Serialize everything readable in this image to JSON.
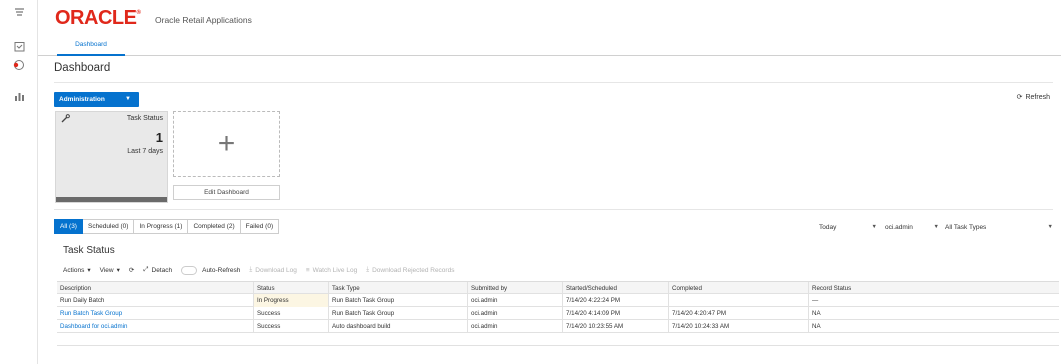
{
  "app": {
    "logo": "ORACLE",
    "app_name": "Oracle Retail Applications"
  },
  "sidebar": {
    "icons": [
      "tasks-icon",
      "calendar-icon",
      "alert-icon",
      "chart-icon"
    ]
  },
  "tabs": {
    "active": "Dashboard"
  },
  "page": {
    "title": "Dashboard"
  },
  "admin": {
    "label": "Administration"
  },
  "refresh": {
    "label": "Refresh"
  },
  "tile": {
    "title": "Task Status",
    "count": "1",
    "period": "Last 7 days"
  },
  "edit_dashboard": "Edit Dashboard",
  "filters": [
    {
      "label": "All (3)",
      "active": true
    },
    {
      "label": "Scheduled (0)",
      "active": false
    },
    {
      "label": "In Progress (1)",
      "active": false
    },
    {
      "label": "Completed (2)",
      "active": false
    },
    {
      "label": "Failed (0)",
      "active": false
    }
  ],
  "selects": {
    "period": "Today",
    "user": "oci.admin",
    "task_type": "All Task Types"
  },
  "section_title": "Task Status",
  "toolbar": {
    "actions": "Actions",
    "view": "View",
    "detach": "Detach",
    "auto_refresh": "Auto-Refresh",
    "download_log": "Download Log",
    "watch_live_log": "Watch Live Log",
    "download_rejected": "Download Rejected Records"
  },
  "table": {
    "columns": [
      "Description",
      "Status",
      "Task Type",
      "Submitted by",
      "Started/Scheduled",
      "Completed",
      "Record Status"
    ],
    "rows": [
      [
        "Run Daily Batch",
        "In Progress",
        "Run Batch Task Group",
        "oci.admin",
        "7/14/20 4:22:24 PM",
        "",
        "—"
      ],
      [
        "Run Batch Task Group",
        "Success",
        "Run Batch Task Group",
        "oci.admin",
        "7/14/20 4:14:09 PM",
        "7/14/20 4:20:47 PM",
        "NA"
      ],
      [
        "Dashboard for oci.admin",
        "Success",
        "Auto dashboard build",
        "oci.admin",
        "7/14/20 10:23:55 AM",
        "7/14/20 10:24:33 AM",
        "NA"
      ]
    ]
  },
  "colors": {
    "accent": "#0572ce",
    "brand": "#e0281b",
    "in_progress_bg": "#fcf6e3"
  }
}
